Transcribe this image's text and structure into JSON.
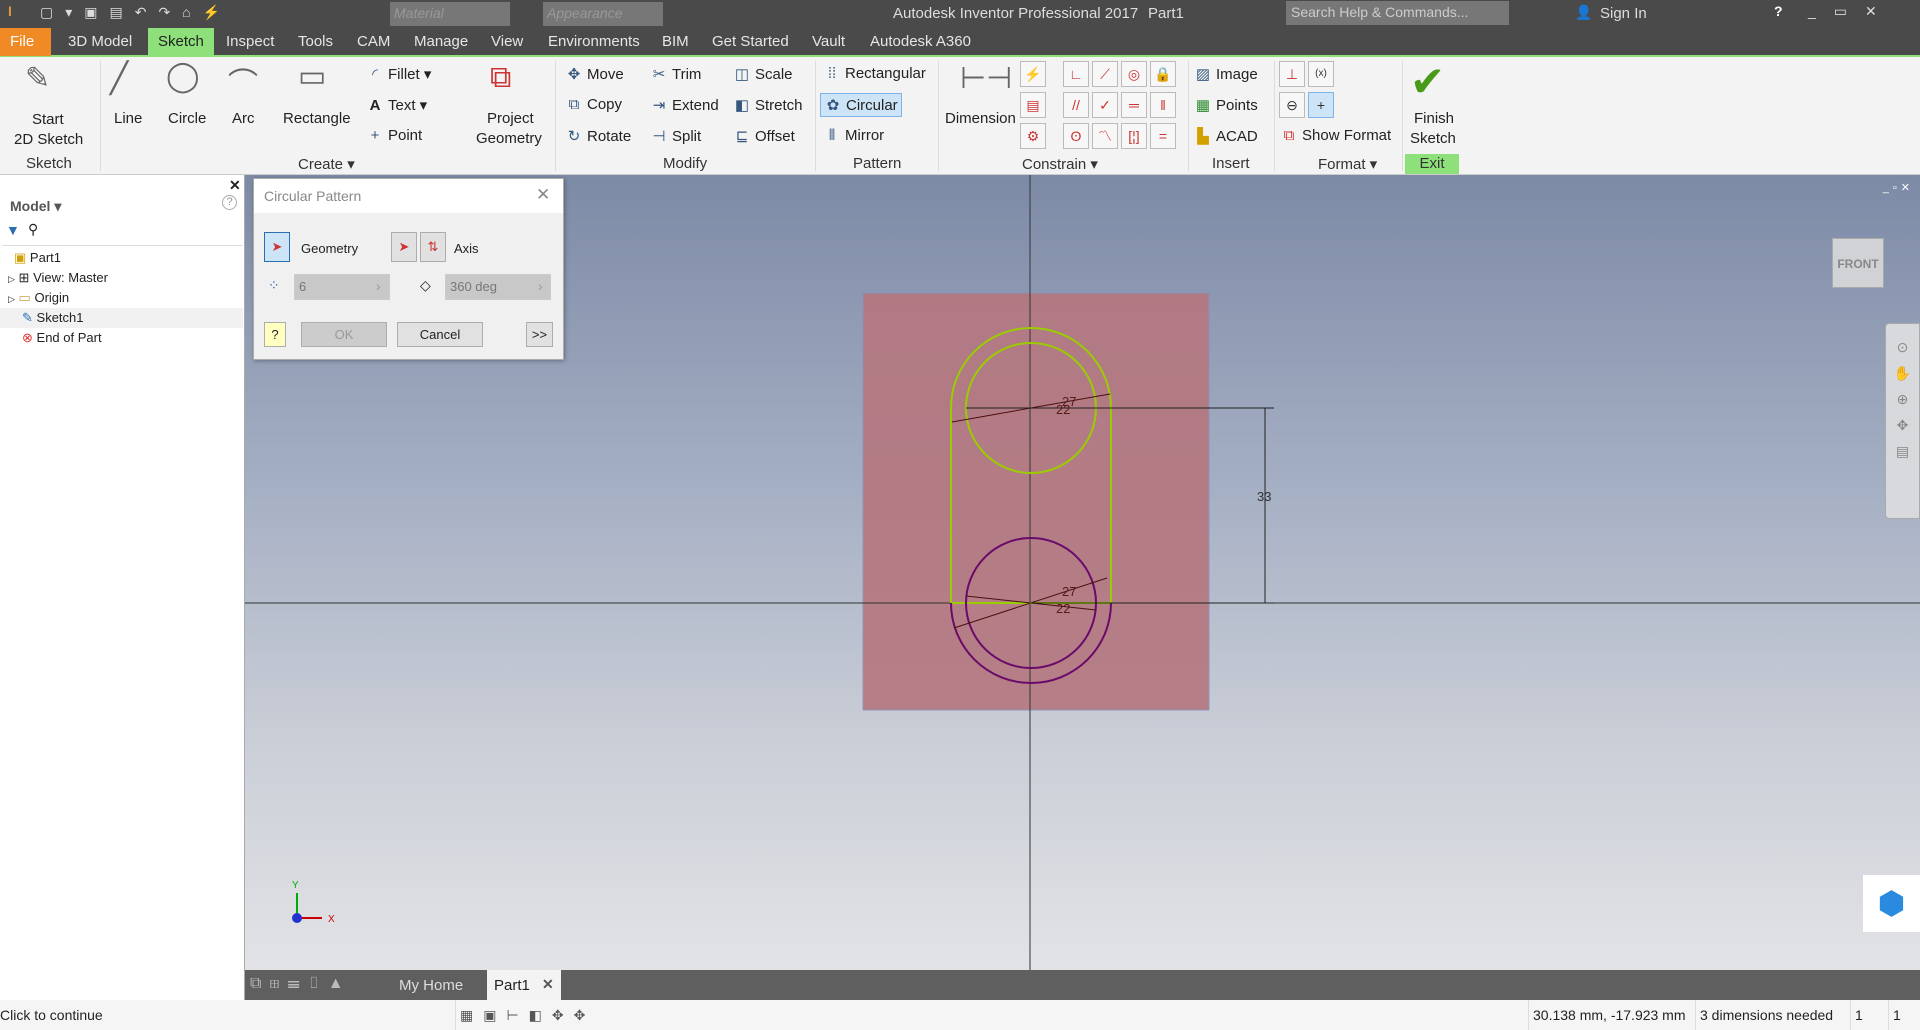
{
  "titlebar": {
    "app_title": "Autodesk Inventor Professional 2017",
    "doc": "Part1",
    "material_placeholder": "Material",
    "appearance_placeholder": "Appearance",
    "search_placeholder": "Search Help & Commands...",
    "sign_in": "Sign In"
  },
  "tabs": [
    "File",
    "3D Model",
    "Sketch",
    "Inspect",
    "Tools",
    "CAM",
    "Manage",
    "View",
    "Environments",
    "BIM",
    "Get Started",
    "Vault",
    "Autodesk A360"
  ],
  "active_tab": "Sketch",
  "ribbon": {
    "sketch": {
      "start": "Start",
      "start2": "2D Sketch",
      "group": "Sketch"
    },
    "create": {
      "line": "Line",
      "circle": "Circle",
      "arc": "Arc",
      "rectangle": "Rectangle",
      "fillet": "Fillet",
      "text": "Text",
      "point": "Point",
      "project": "Project",
      "project2": "Geometry",
      "group": "Create ▾"
    },
    "modify": {
      "move": "Move",
      "copy": "Copy",
      "rotate": "Rotate",
      "trim": "Trim",
      "extend": "Extend",
      "split": "Split",
      "scale": "Scale",
      "stretch": "Stretch",
      "offset": "Offset",
      "group": "Modify"
    },
    "pattern": {
      "rectangular": "Rectangular",
      "circular": "Circular",
      "mirror": "Mirror",
      "group": "Pattern"
    },
    "constrain": {
      "dimension": "Dimension",
      "group": "Constrain ▾"
    },
    "insert": {
      "image": "Image",
      "points": "Points",
      "acad": "ACAD",
      "group": "Insert"
    },
    "format": {
      "show_format": "Show Format",
      "group": "Format ▾"
    },
    "exit": {
      "finish": "Finish",
      "finish2": "Sketch",
      "group": "Exit"
    }
  },
  "browser": {
    "title": "Model ▾",
    "items": [
      "Part1",
      "View: Master",
      "Origin",
      "Sketch1",
      "End of Part"
    ]
  },
  "dialog": {
    "title": "Circular Pattern",
    "geometry": "Geometry",
    "axis": "Axis",
    "count": "6",
    "angle": "360 deg",
    "ok": "OK",
    "cancel": "Cancel",
    "more": ">>"
  },
  "sketch": {
    "dim_outer_top": "27",
    "dim_inner_top": "22",
    "dim_outer_bot": "27",
    "dim_inner_bot": "22",
    "dim_distance": "33"
  },
  "viewcube": "FRONT",
  "triad": {
    "x": "X",
    "y": "Y"
  },
  "doctabs": {
    "home": "My Home",
    "part": "Part1"
  },
  "status": {
    "message": "Click to continue",
    "coords": "30.138 mm, -17.923 mm",
    "dims": "3 dimensions needed",
    "c1": "1",
    "c2": "1"
  },
  "colors": {
    "file_tab": "#f08a24",
    "active_tab": "#8ee07a",
    "sketch_active": "#9acd00",
    "sketch_purple": "#6a0a6a",
    "face": "#b5777f"
  }
}
